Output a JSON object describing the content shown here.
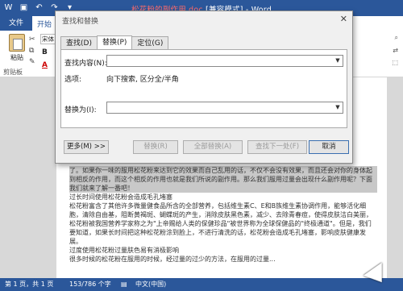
{
  "titlebar": {
    "title_prefix": "",
    "title_highlight": "松花粉的副作用.doc",
    "title_suffix": " [兼容模式] - Word",
    "qat_icons": [
      "word-logo-icon",
      "save-icon",
      "undo-icon",
      "redo-icon",
      "customize-icon"
    ]
  },
  "ribbon": {
    "tab_file": "文件",
    "tab_start": "开始",
    "paste_label": "粘贴",
    "clipboard_label": "剪贴板",
    "font_name": "宋体",
    "bold_label": "B",
    "font_color_label": "A"
  },
  "dialog": {
    "title": "查找和替换",
    "tabs": [
      "查找(D)",
      "替换(P)",
      "定位(G)"
    ],
    "active_tab": "替换(P)",
    "find_label": "查找内容(N):",
    "find_value": "",
    "options_label": "选项:",
    "options_value": "向下搜索, 区分全/半角",
    "replace_label": "替换为(I):",
    "replace_value": "",
    "more_button": "更多(M) >>",
    "replace_button": "替换(R)",
    "replace_all_button": "全部替换(A)",
    "find_next_button": "查找下一处(F)",
    "cancel_button": "取消"
  },
  "document": {
    "paragraphs": [
      "了。如果你一味的服用松花粉来达到它的效果而自己乱用的话，不仅不会没有效果，而且还会对你的身体起到相反的作用，而这个相反的作用也就是我们所说的副作用。那么我们服用过量会出现什么副作用呢？下面我们就来了解一番吧！",
      "过长时间使用松花粉会造成毛孔堵塞",
      "松花粉富含了其他许多微量健食品所含的全部营养，包括维生素C、E和B族维生素协调作用，能够活化细胞，清除自由基，阻断黄褐斑、蝴蝶斑的产生，消除皮肤黑色素，减少、去除青春痘，使得皮肤洁白美丽，松花粉被我国营养学家称之为\"上帝赐给人类的保健珍品\"被世界称为全球保健品的\"终极通道\"。但是，我们要知道，如果长时间把这种松花粉涂到脸上，不进行清洗的话，松花粉会造成毛孔堵塞，影响皮肤健康发展。",
      "过度使用松花粉过量肤色易有消极影响",
      "很多时候的松花粉在服用的时候，经过量的过少的方法，在服用的过量..."
    ]
  },
  "statusbar": {
    "page": "第 1 页，共 1 页",
    "words": "153/786 个字",
    "language": "中文(中国)",
    "proofing_icon": "proofing-icon"
  }
}
